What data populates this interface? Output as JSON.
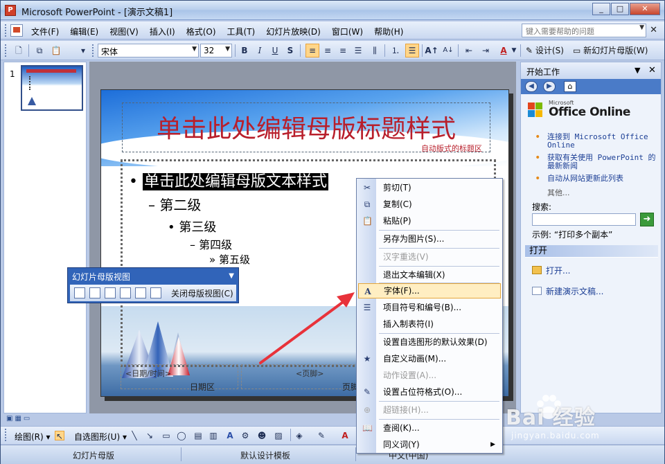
{
  "window": {
    "title": "Microsoft PowerPoint - [演示文稿1]",
    "app_icon": "P",
    "buttons": [
      "_",
      "□",
      "✕"
    ]
  },
  "menubar": {
    "items": [
      "文件(F)",
      "编辑(E)",
      "视图(V)",
      "插入(I)",
      "格式(O)",
      "工具(T)",
      "幻灯片放映(D)",
      "窗口(W)",
      "帮助(H)"
    ],
    "help_placeholder": "键入需要帮助的问题",
    "close": "✕"
  },
  "toolbar": {
    "font": "宋体",
    "size": "32",
    "bold": "B",
    "italic": "I",
    "underline": "U",
    "shadow": "S",
    "design": "设计(S)",
    "new_slide": "新幻灯片母版(W)"
  },
  "thumbnail": {
    "number": "1"
  },
  "slide": {
    "title": "单击此处编辑母版标题样式",
    "title_area_label": "自动版式的标题区",
    "levels": [
      "单击此处编辑母版文本样式",
      "第二级",
      "第三级",
      "第四级",
      "第五级"
    ],
    "bullets": [
      "•",
      "–",
      "•",
      "–",
      "»"
    ],
    "footer_date_placeholder": "<日期/时间>",
    "footer_page_placeholder": "<页脚>",
    "footer_date_label": "日期区",
    "footer_page_label": "页脚"
  },
  "master_toolbar": {
    "title": "幻灯片母版视图",
    "close_label": "关闭母版视图(C)"
  },
  "context_menu": {
    "items": [
      {
        "label": "剪切(T)",
        "icon": "✂",
        "disabled": false
      },
      {
        "label": "复制(C)",
        "icon": "⧉",
        "disabled": false
      },
      {
        "label": "粘贴(P)",
        "icon": "📋",
        "disabled": false
      },
      {
        "label": "另存为图片(S)...",
        "icon": "",
        "disabled": false
      },
      {
        "label": "汉字重选(V)",
        "icon": "",
        "disabled": true
      },
      {
        "label": "退出文本编辑(X)",
        "icon": "",
        "disabled": false
      },
      {
        "label": "字体(F)...",
        "icon": "A",
        "disabled": false,
        "hover": true
      },
      {
        "label": "项目符号和编号(B)...",
        "icon": "☰",
        "disabled": false
      },
      {
        "label": "插入制表符(I)",
        "icon": "",
        "disabled": false
      },
      {
        "label": "设置自选图形的默认效果(D)",
        "icon": "",
        "disabled": false
      },
      {
        "label": "自定义动画(M)...",
        "icon": "★",
        "disabled": false
      },
      {
        "label": "动作设置(A)...",
        "icon": "",
        "disabled": true
      },
      {
        "label": "设置占位符格式(O)...",
        "icon": "✎",
        "disabled": false
      },
      {
        "label": "超链接(H)...",
        "icon": "⊕",
        "disabled": true
      },
      {
        "label": "查阅(K)...",
        "icon": "📖",
        "disabled": false
      },
      {
        "label": "同义词(Y)",
        "icon": "",
        "disabled": false,
        "submenu": true
      }
    ]
  },
  "task_pane": {
    "title": "开始工作",
    "logo_small": "Microsoft",
    "logo_text": "Office Online",
    "links": [
      "连接到 Microsoft Office Online",
      "获取有关使用 PowerPoint 的最新新闻",
      "自动从网站更新此列表"
    ],
    "more": "其他...",
    "search_label": "搜索:",
    "example": "示例:  “打印多个副本”",
    "open_section": "打开",
    "open_items": [
      "打开...",
      "新建演示文稿..."
    ]
  },
  "drawing_toolbar": {
    "draw": "绘图(R)",
    "autoshapes": "自选图形(U)"
  },
  "status_bar": {
    "view": "幻灯片母版",
    "template": "默认设计模板",
    "language": "中文(中国)"
  },
  "watermark": {
    "text": "Bai 经验",
    "url": "jingyan.baidu.com"
  },
  "colors": {
    "title_red": "#b81f2b",
    "highlight": "#ffeec2",
    "accent_blue": "#3164b9"
  }
}
